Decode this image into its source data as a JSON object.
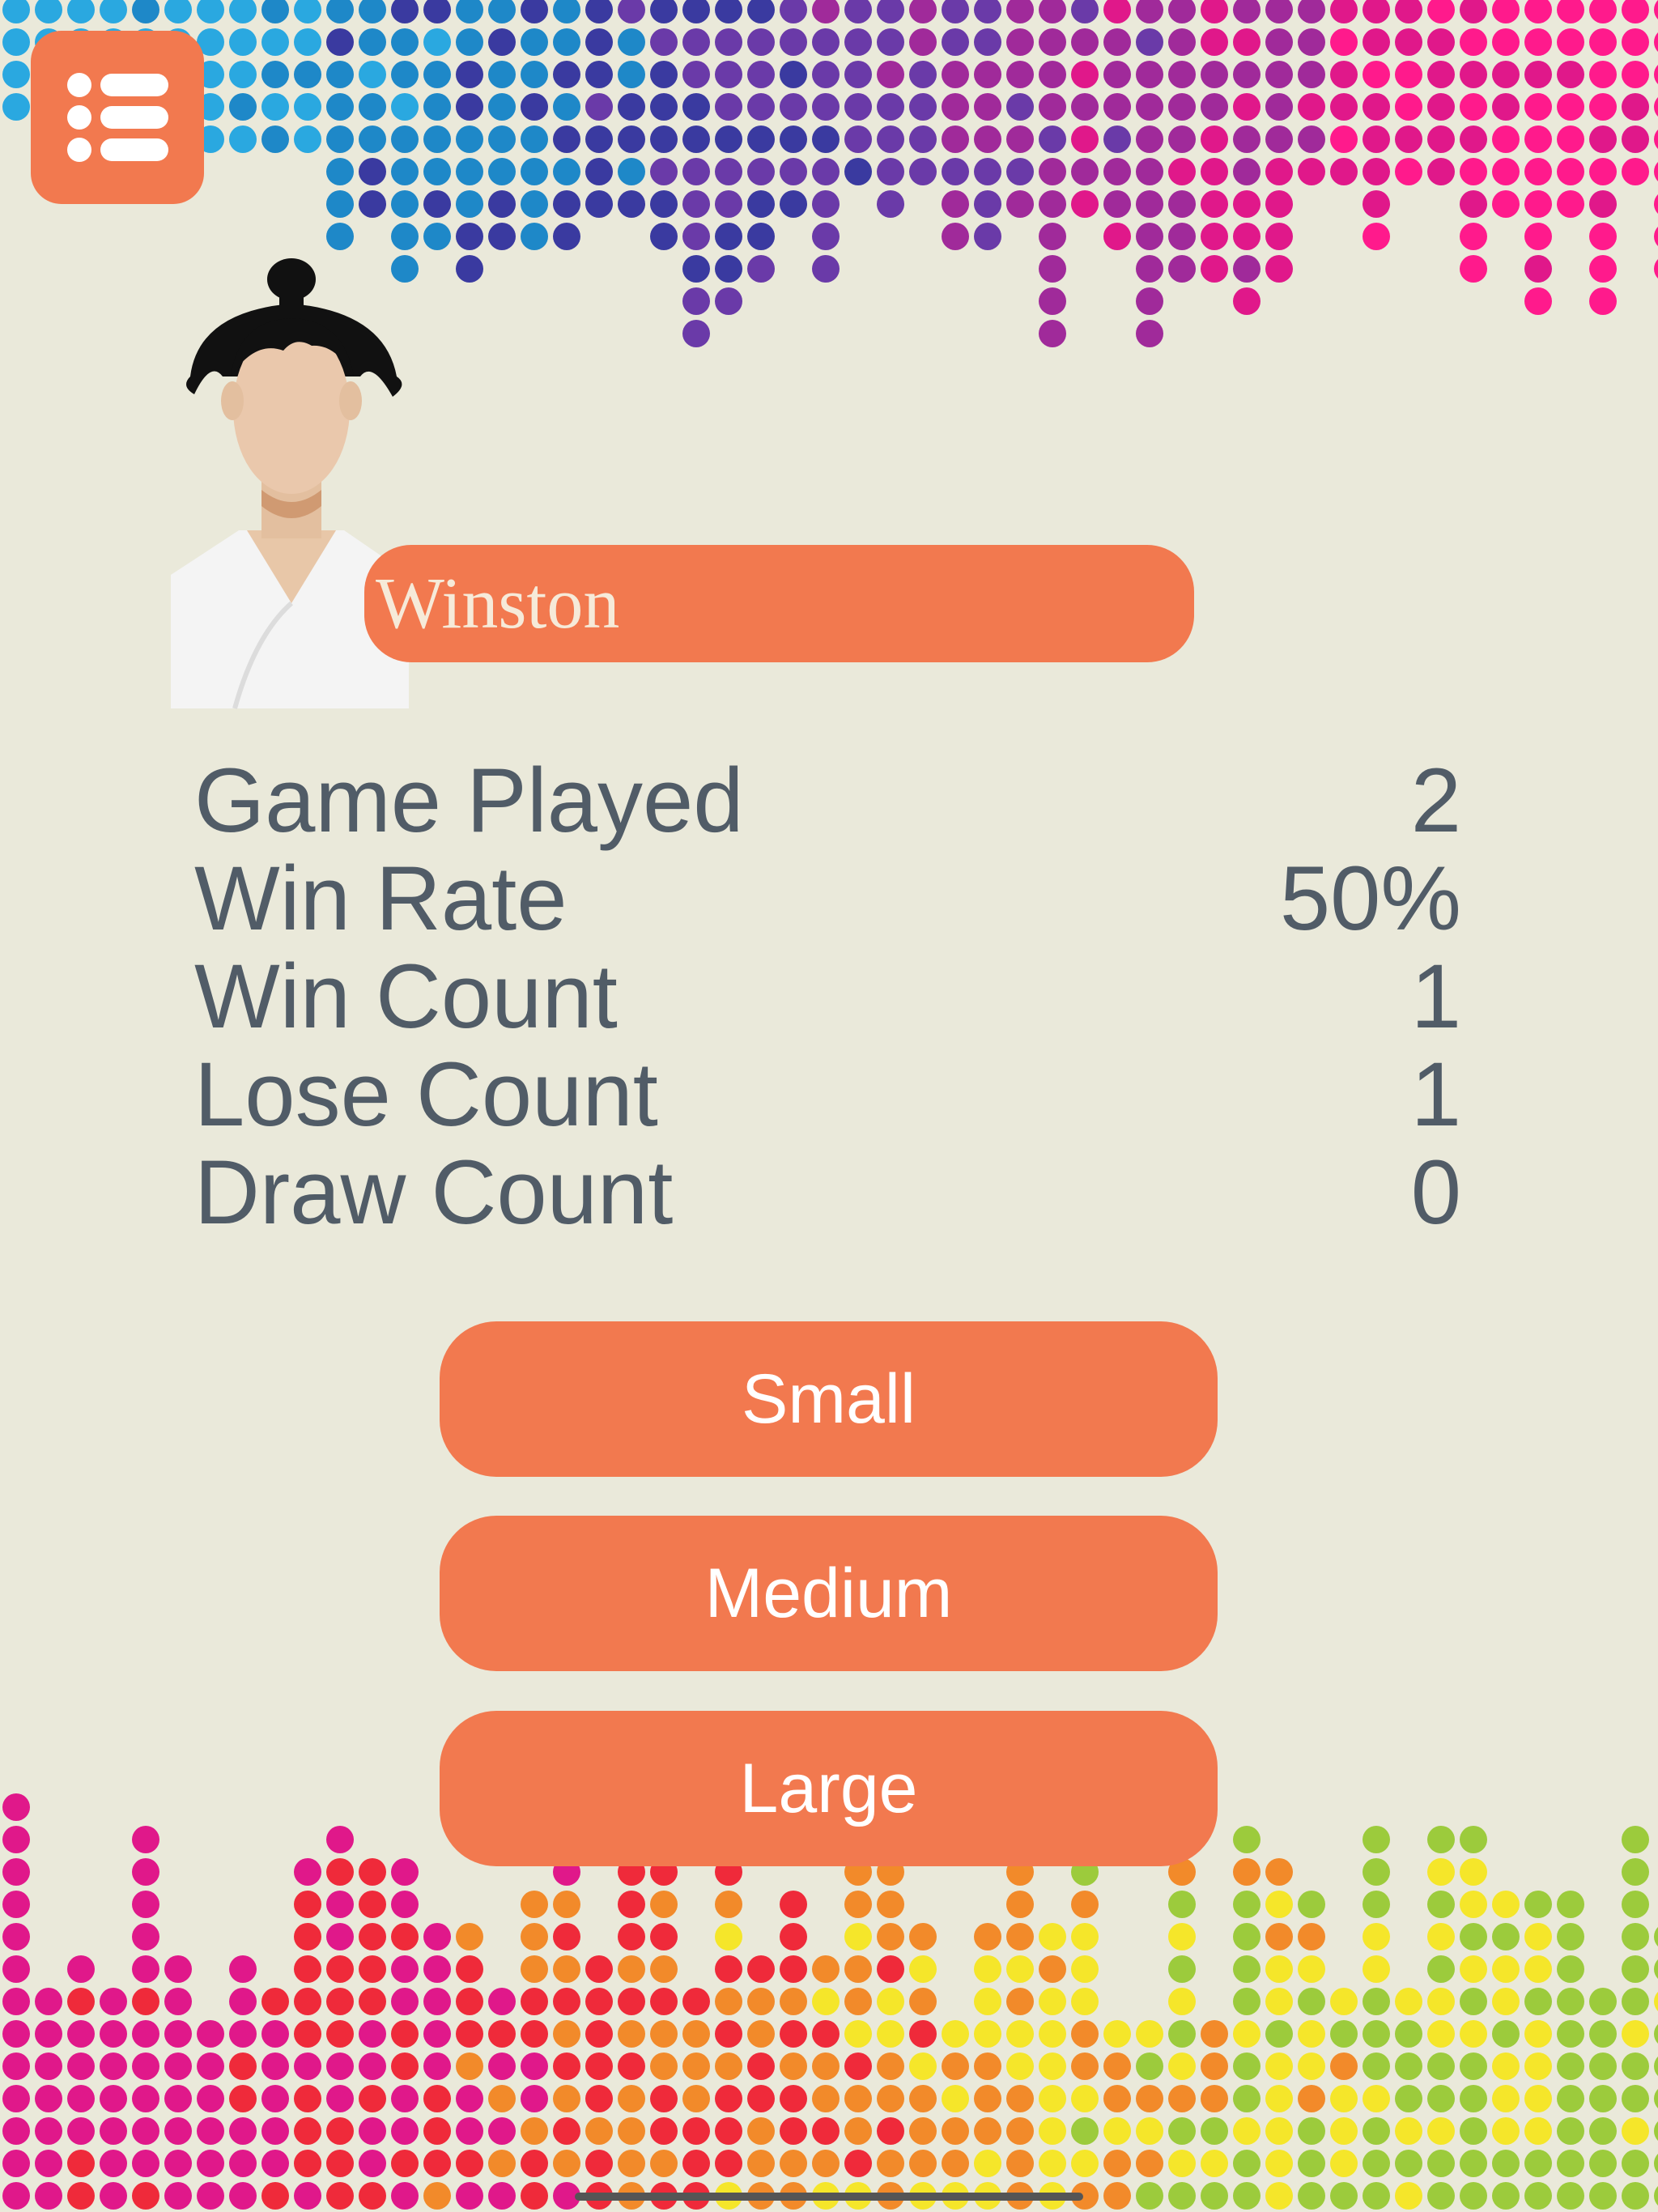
{
  "menu": {
    "icon": "list-icon"
  },
  "player": {
    "name": "Winston",
    "avatar": "sumo-wrestler-avatar"
  },
  "stats": [
    {
      "label": "Game Played",
      "value": "2"
    },
    {
      "label": "Win Rate",
      "value": "50%"
    },
    {
      "label": "Win Count",
      "value": "1"
    },
    {
      "label": "Lose Count",
      "value": "1"
    },
    {
      "label": "Draw Count",
      "value": "0"
    }
  ],
  "board_sizes": {
    "small": "Small",
    "medium": "Medium",
    "large": "Large"
  },
  "colors": {
    "background": "#eae9da",
    "accent": "#f2794f",
    "stat_text": "#515c67",
    "top_dot_palette": [
      "#2aa8e0",
      "#1e88c8",
      "#3a3aa0",
      "#6a3aa8",
      "#a02a9a",
      "#e0188a",
      "#ff1a8c"
    ],
    "bottom_dot_palette": [
      "#e0188a",
      "#ef2a3a",
      "#f28a2a",
      "#f5e62a",
      "#9ccb3c"
    ]
  }
}
